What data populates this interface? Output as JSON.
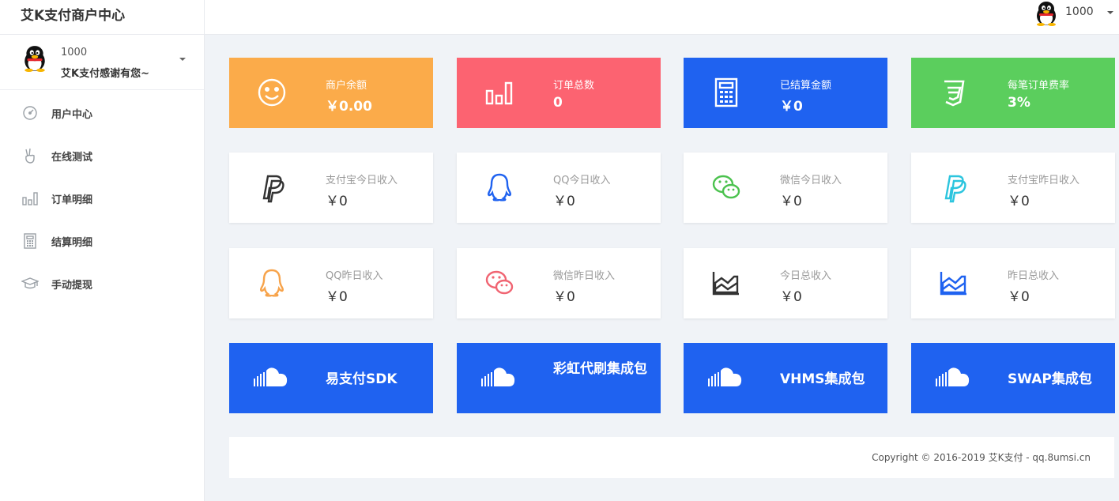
{
  "app": {
    "title": "艾K支付商户中心"
  },
  "topbar": {
    "username": "1000"
  },
  "sidebar": {
    "profile": {
      "uid": "1000",
      "greeting": "艾K支付感谢有您~"
    },
    "items": [
      {
        "label": "用户中心",
        "icon": "dashboard-icon"
      },
      {
        "label": "在线测试",
        "icon": "hand-peace-icon"
      },
      {
        "label": "订单明细",
        "icon": "bar-chart-icon"
      },
      {
        "label": "结算明细",
        "icon": "calculator-icon"
      },
      {
        "label": "手动提现",
        "icon": "graduation-cap-icon"
      }
    ]
  },
  "stats": [
    {
      "label": "商户余额",
      "value": "￥0.00",
      "color": "#fbab4a",
      "icon": "smile-icon"
    },
    {
      "label": "订单总数",
      "value": "0",
      "color": "#fc6371",
      "icon": "bar-chart-icon"
    },
    {
      "label": "已结算金额",
      "value": "￥0",
      "color": "#1f62f0",
      "icon": "calculator-icon"
    },
    {
      "label": "每笔订单费率",
      "value": "3%",
      "color": "#5bce5d",
      "icon": "css3-icon"
    }
  ],
  "income": [
    {
      "label": "支付宝今日收入",
      "value": "￥0",
      "icon": "paypal-icon",
      "color": "#333333"
    },
    {
      "label": "QQ今日收入",
      "value": "￥0",
      "icon": "qq-icon",
      "color": "#1f62f0"
    },
    {
      "label": "微信今日收入",
      "value": "￥0",
      "icon": "wechat-icon",
      "color": "#4bc24e"
    },
    {
      "label": "支付宝昨日收入",
      "value": "￥0",
      "icon": "paypal-icon",
      "color": "#2cc5de"
    },
    {
      "label": "QQ昨日收入",
      "value": "￥0",
      "icon": "qq-icon",
      "color": "#f7a34a"
    },
    {
      "label": "微信昨日收入",
      "value": "￥0",
      "icon": "wechat-icon",
      "color": "#f06472"
    },
    {
      "label": "今日总收入",
      "value": "￥0",
      "icon": "area-chart-icon",
      "color": "#333333"
    },
    {
      "label": "昨日总收入",
      "value": "￥0",
      "icon": "area-chart-icon",
      "color": "#1f62f0"
    }
  ],
  "downloads": [
    {
      "label": "易支付SDK",
      "icon": "soundcloud-icon"
    },
    {
      "label": "彩虹代刷集成包",
      "icon": "soundcloud-icon"
    },
    {
      "label": "VHMS集成包",
      "icon": "soundcloud-icon"
    },
    {
      "label": "SWAP集成包",
      "icon": "soundcloud-icon"
    }
  ],
  "colors": {
    "accent": "#1f62f0"
  },
  "footer": {
    "copyright": "Copyright © 2016-2019 艾K支付 - qq.8umsi.cn"
  }
}
